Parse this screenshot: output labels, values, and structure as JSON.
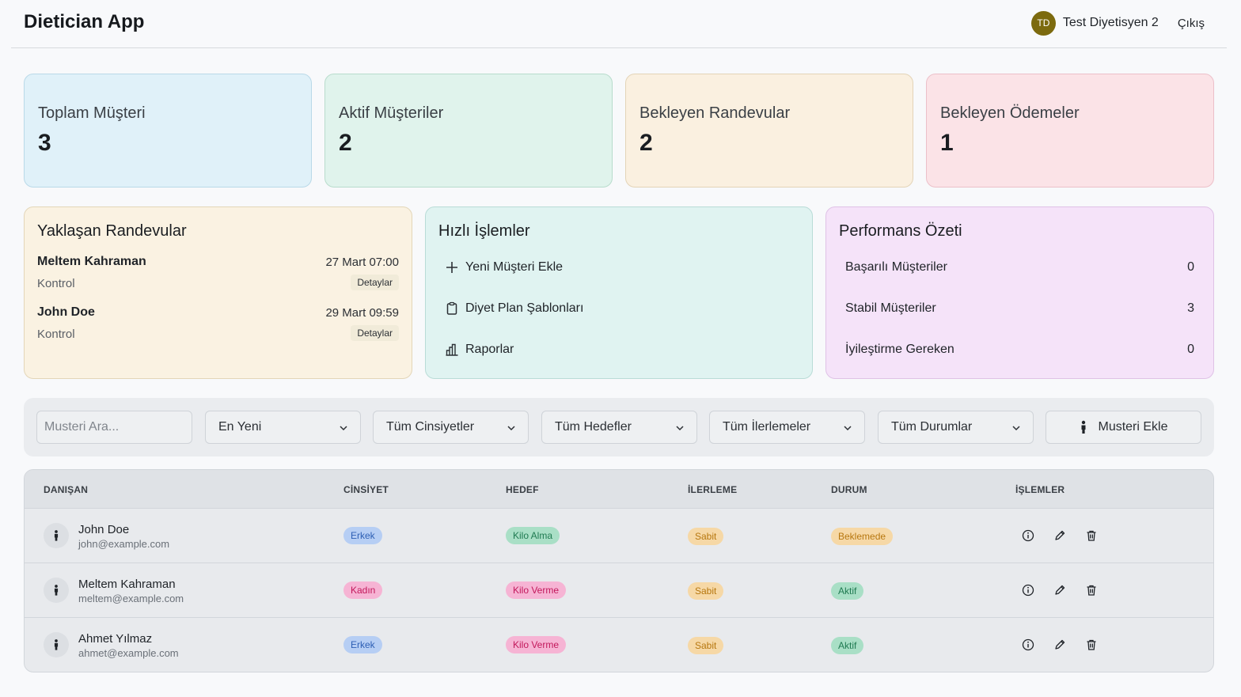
{
  "header": {
    "app_title": "Dietician App",
    "avatar_initials": "TD",
    "user_name": "Test Diyetisyen 2",
    "logout_label": "Çıkış"
  },
  "stats": [
    {
      "label": "Toplam Müşteri",
      "value": "3",
      "bg": "#e0f1f9",
      "border": "#b9d9e8"
    },
    {
      "label": "Aktif Müşteriler",
      "value": "2",
      "bg": "#e0f3ec",
      "border": "#b8dccc"
    },
    {
      "label": "Bekleyen Randevular",
      "value": "2",
      "bg": "#faf0e0",
      "border": "#e3d4b7"
    },
    {
      "label": "Bekleyen Ödemeler",
      "value": "1",
      "bg": "#fbe3e7",
      "border": "#ecc0c9"
    }
  ],
  "upcoming": {
    "title": "Yaklaşan Randevular",
    "items": [
      {
        "name": "Meltem Kahraman",
        "date": "27 Mart 07:00",
        "type": "Kontrol",
        "details_label": "Detaylar"
      },
      {
        "name": "John Doe",
        "date": "29 Mart 09:59",
        "type": "Kontrol",
        "details_label": "Detaylar"
      }
    ]
  },
  "quick_actions": {
    "title": "Hızlı İşlemler",
    "items": [
      {
        "label": "Yeni Müşteri Ekle",
        "icon": "plus-icon"
      },
      {
        "label": "Diyet Plan Şablonları",
        "icon": "clipboard-icon"
      },
      {
        "label": "Raporlar",
        "icon": "bar-chart-icon"
      }
    ]
  },
  "performance": {
    "title": "Performans Özeti",
    "items": [
      {
        "label": "Başarılı Müşteriler",
        "value": "0"
      },
      {
        "label": "Stabil Müşteriler",
        "value": "3"
      },
      {
        "label": "İyileştirme Gereken",
        "value": "0"
      }
    ]
  },
  "filters": {
    "search_placeholder": "Musteri Ara...",
    "sort": "En Yeni",
    "gender": "Tüm Cinsiyetler",
    "goal": "Tüm Hedefler",
    "progress": "Tüm İlerlemeler",
    "status": "Tüm Durumlar",
    "add_label": "Musteri Ekle"
  },
  "table": {
    "headers": [
      "DANIŞAN",
      "CİNSİYET",
      "HEDEF",
      "İLERLEME",
      "DURUM",
      "İŞLEMLER"
    ],
    "rows": [
      {
        "name": "John Doe",
        "email": "john@example.com",
        "gender": "Erkek",
        "goal": "Kilo Alma",
        "progress": "Sabit",
        "status": "Beklemede"
      },
      {
        "name": "Meltem Kahraman",
        "email": "meltem@example.com",
        "gender": "Kadın",
        "goal": "Kilo Verme",
        "progress": "Sabit",
        "status": "Aktif"
      },
      {
        "name": "Ahmet Yılmaz",
        "email": "ahmet@example.com",
        "gender": "Erkek",
        "goal": "Kilo Verme",
        "progress": "Sabit",
        "status": "Aktif"
      }
    ]
  }
}
